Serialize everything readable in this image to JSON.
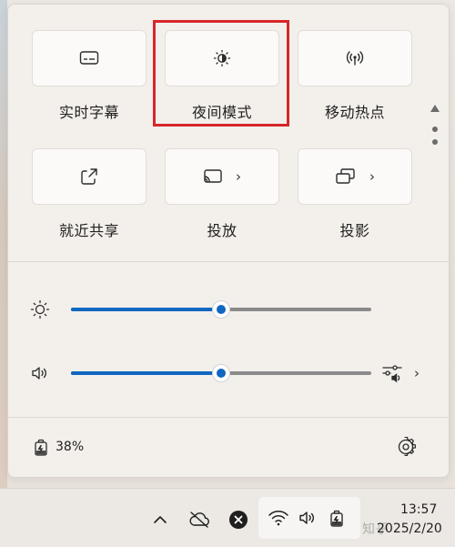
{
  "quick_settings": {
    "tiles": [
      {
        "id": "live-captions",
        "label": "实时字幕",
        "icon": "captions-icon",
        "has_chevron": false
      },
      {
        "id": "night-light",
        "label": "夜间模式",
        "icon": "night-light-icon",
        "has_chevron": false
      },
      {
        "id": "mobile-hotspot",
        "label": "移动热点",
        "icon": "hotspot-icon",
        "has_chevron": false
      },
      {
        "id": "nearby-sharing",
        "label": "就近共享",
        "icon": "share-icon",
        "has_chevron": false
      },
      {
        "id": "cast",
        "label": "投放",
        "icon": "cast-icon",
        "has_chevron": true,
        "chevron": "›"
      },
      {
        "id": "project",
        "label": "投影",
        "icon": "project-icon",
        "has_chevron": true,
        "chevron": "›"
      }
    ],
    "highlighted_tile": "night-light",
    "highlight_color": "#d7262a",
    "pager": {
      "pages": 2,
      "current": 1
    }
  },
  "sliders": {
    "brightness": {
      "icon": "brightness-icon",
      "value_fraction": 0.5
    },
    "volume": {
      "icon": "speaker-icon",
      "value_fraction": 0.5,
      "extra_icon": "audio-output-icon",
      "chevron": "›"
    }
  },
  "footer": {
    "battery_icon": "battery-charging-icon",
    "battery_percent": "38%",
    "settings_icon": "gear-icon"
  },
  "taskbar": {
    "icons": [
      "chevron-up-icon",
      "cloud-off-icon",
      "close-circle-icon",
      "wifi-icon",
      "speaker-icon",
      "battery-charging-icon"
    ],
    "time": "13:57",
    "date": "2025/2/20",
    "watermark": "知乎"
  },
  "colors": {
    "accent": "#0f67c0",
    "panel_bg": "#f3efeb",
    "tile_bg": "#fbfaf9"
  }
}
